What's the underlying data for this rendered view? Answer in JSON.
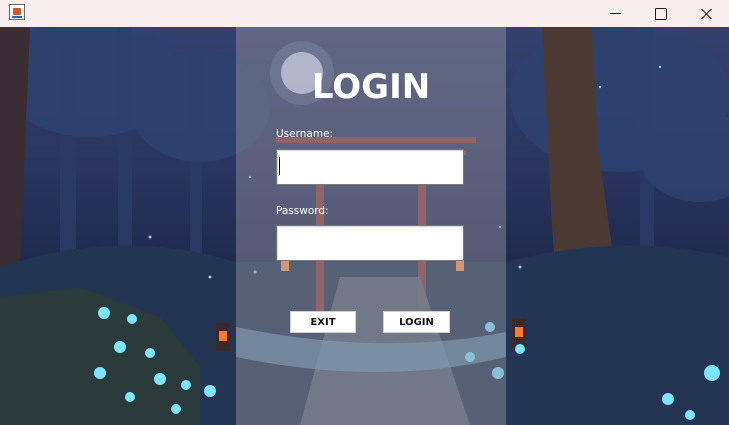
{
  "window": {
    "icon": "java-app-icon",
    "controls": [
      "minimize-icon",
      "maximize-icon",
      "close-icon"
    ]
  },
  "login": {
    "title": "LOGIN",
    "username_label": "Username:",
    "username_value": "",
    "password_label": "Password:",
    "password_value": "",
    "exit_label": "EXIT",
    "login_label": "LOGIN"
  },
  "colors": {
    "titlebar": "#f9eeee",
    "panel": "rgba(150,150,160,0.45)",
    "sky": "#34406d",
    "flowers": "#7fe4ff",
    "lantern": "#ff7a30"
  }
}
